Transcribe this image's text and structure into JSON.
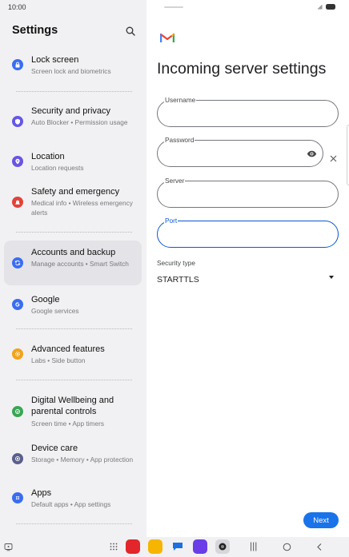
{
  "status_bar": {
    "time": "10:00"
  },
  "settings": {
    "title": "Settings",
    "items": [
      {
        "title": "Lock screen",
        "subtitle": "Screen lock and biometrics",
        "icon": "lock-icon",
        "color": "#3a6df0"
      },
      {
        "title": "Security and privacy",
        "subtitle": "Auto Blocker • Permission usage",
        "icon": "shield-icon",
        "color": "#6557e6"
      },
      {
        "title": "Location",
        "subtitle": "Location requests",
        "icon": "location-pin-icon",
        "color": "#6b54e2"
      },
      {
        "title": "Safety and emergency",
        "subtitle": "Medical info • Wireless emergency alerts",
        "icon": "alert-icon",
        "color": "#e0433a"
      },
      {
        "title": "Accounts and backup",
        "subtitle": "Manage accounts • Smart Switch",
        "icon": "sync-icon",
        "color": "#3a6df0"
      },
      {
        "title": "Google",
        "subtitle": "Google services",
        "icon": "google-icon",
        "color": "#3a6df0"
      },
      {
        "title": "Advanced features",
        "subtitle": "Labs • Side button",
        "icon": "gear-icon",
        "color": "#f2a31b"
      },
      {
        "title": "Digital Wellbeing and parental controls",
        "subtitle": "Screen time • App timers",
        "icon": "wellbeing-icon",
        "color": "#3aa655"
      },
      {
        "title": "Device care",
        "subtitle": "Storage • Memory • App protection",
        "icon": "device-care-icon",
        "color": "#5b5f8c"
      },
      {
        "title": "Apps",
        "subtitle": "Default apps • App settings",
        "icon": "apps-icon",
        "color": "#3a6df0"
      }
    ]
  },
  "incoming": {
    "title": "Incoming server settings",
    "username_label": "Username",
    "password_label": "Password",
    "server_label": "Server",
    "port_label": "Port",
    "security_label": "Security type",
    "security_value": "STARTTLS",
    "next_label": "Next"
  },
  "colors": {
    "accent": "#1a73e8",
    "focus": "#0b57d0"
  }
}
